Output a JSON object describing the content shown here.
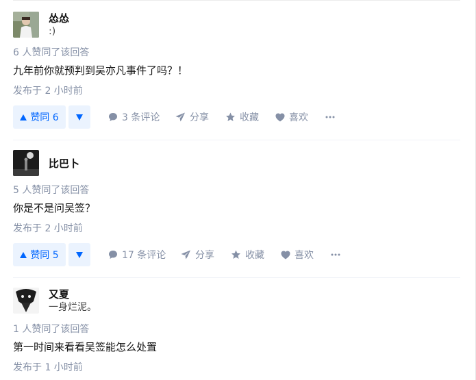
{
  "answers": [
    {
      "author": "怂怂",
      "headline": ":)",
      "votes_text": "6 人赞同了该回答",
      "content": "九年前你就预判到吴亦凡事件了吗？！",
      "time": "发布于 2 小时前",
      "vote_label": "赞同 6",
      "comments": "3 条评论",
      "share": "分享",
      "collect": "收藏",
      "like": "喜欢"
    },
    {
      "author": "比巴卜",
      "votes_text": "5 人赞同了该回答",
      "content": "你是不是问吴签？",
      "time": "发布于 2 小时前",
      "vote_label": "赞同 5",
      "comments": "17 条评论",
      "share": "分享",
      "collect": "收藏",
      "like": "喜欢"
    },
    {
      "author": "又夏",
      "headline": "一身烂泥。",
      "votes_text": "1 人赞同了该回答",
      "content": "第一时间来看看吴签能怎么处置",
      "time": "发布于 1 小时前"
    }
  ],
  "colors": {
    "accent": "#0066ff",
    "vote_bg": "#ebf3fe",
    "meta": "#8590a6"
  },
  "icons": [
    "triangle-up-icon",
    "triangle-down-icon",
    "comment-icon",
    "share-icon",
    "star-icon",
    "heart-icon",
    "more-icon"
  ]
}
